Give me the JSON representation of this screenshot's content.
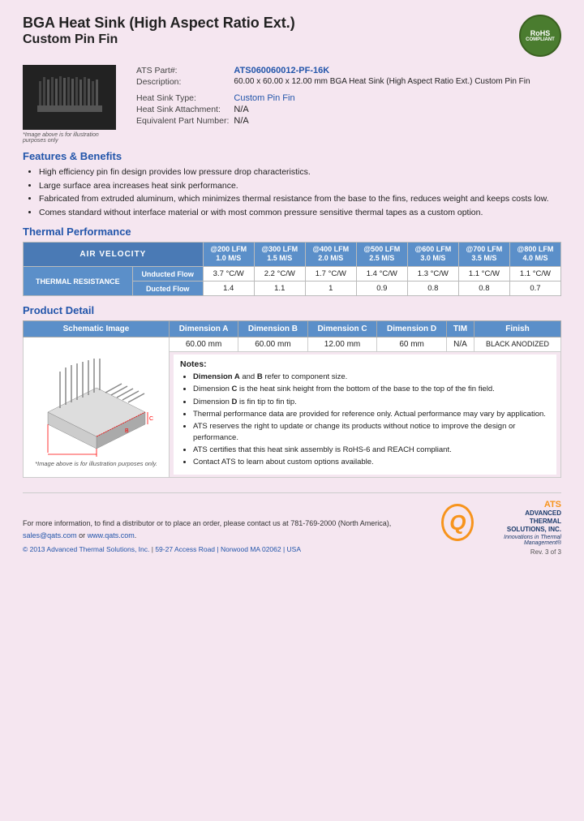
{
  "title": {
    "line1": "BGA Heat Sink (High Aspect Ratio Ext.)",
    "line2": "Custom Pin Fin"
  },
  "rohs": {
    "line1": "RoHS",
    "line2": "COMPLIANT"
  },
  "specs": {
    "part_label": "ATS Part#:",
    "part_value": "ATS060060012-PF-16K",
    "desc_label": "Description:",
    "desc_value": "60.00 x 60.00 x 12.00 mm BGA Heat Sink (High Aspect Ratio Ext.) Custom Pin Fin",
    "type_label": "Heat Sink Type:",
    "type_value": "Custom Pin Fin",
    "attach_label": "Heat Sink Attachment:",
    "attach_value": "N/A",
    "equiv_label": "Equivalent Part Number:",
    "equiv_value": "N/A"
  },
  "img_caption": "*Image above is for illustration purposes only",
  "features": {
    "title": "Features & Benefits",
    "items": [
      "High efficiency pin fin design provides low pressure drop characteristics.",
      "Large surface area increases heat sink performance.",
      "Fabricated from extruded aluminum, which minimizes thermal resistance from the base to the fins, reduces weight and keeps costs low.",
      "Comes standard without interface material or with most common pressure sensitive thermal tapes as a custom option."
    ]
  },
  "thermal": {
    "title": "Thermal Performance",
    "table": {
      "header_col1": "AIR VELOCITY",
      "columns": [
        "@200 LFM\n1.0 M/S",
        "@300 LFM\n1.5 M/S",
        "@400 LFM\n2.0 M/S",
        "@500 LFM\n2.5 M/S",
        "@600 LFM\n3.0 M/S",
        "@700 LFM\n3.5 M/S",
        "@800 LFM\n4.0 M/S"
      ],
      "row_label": "THERMAL RESISTANCE",
      "rows": [
        {
          "label": "Unducted Flow",
          "values": [
            "3.7 °C/W",
            "2.2 °C/W",
            "1.7 °C/W",
            "1.4 °C/W",
            "1.3 °C/W",
            "1.1 °C/W",
            "1.1 °C/W"
          ]
        },
        {
          "label": "Ducted Flow",
          "values": [
            "1.4",
            "1.1",
            "1",
            "0.9",
            "0.8",
            "0.8",
            "0.7"
          ]
        }
      ]
    }
  },
  "product_detail": {
    "title": "Product Detail",
    "table_headers": [
      "Schematic Image",
      "Dimension A",
      "Dimension B",
      "Dimension C",
      "Dimension D",
      "TIM",
      "Finish"
    ],
    "dimensions": {
      "dim_a": "60.00 mm",
      "dim_b": "60.00 mm",
      "dim_c": "12.00 mm",
      "dim_d": "60 mm",
      "tim": "N/A",
      "finish": "BLACK ANODIZED"
    },
    "schematic_caption": "*Image above is for illustration purposes only.",
    "notes_title": "Notes:",
    "notes": [
      "Dimension A and B refer to component size.",
      "Dimension C is the heat sink height from the bottom of the base to the top of the fin field.",
      "Dimension D is fin tip to fin tip.",
      "Thermal performance data are provided for reference only. Actual performance may vary by application.",
      "ATS reserves the right to update or change its products without notice to improve the design or performance.",
      "ATS certifies that this heat sink assembly is RoHS-6 and REACH compliant.",
      "Contact ATS to learn about custom options available."
    ]
  },
  "footer": {
    "contact_text": "For more information, to find a distributor or to place an order, please contact us at",
    "phone": "781-769-2000 (North America)",
    "email": "sales@qats.com",
    "website": "www.qats.com",
    "copyright": "© 2013 Advanced Thermal Solutions, Inc.",
    "address": "59-27 Access Road  |  Norwood MA  02062  |  USA",
    "ats_name1": "ADVANCED",
    "ats_name2": "THERMAL",
    "ats_name3": "SOLUTIONS, INC.",
    "tagline": "Innovations in Thermal Management®",
    "page_num": "Rev. 3 of 3"
  }
}
